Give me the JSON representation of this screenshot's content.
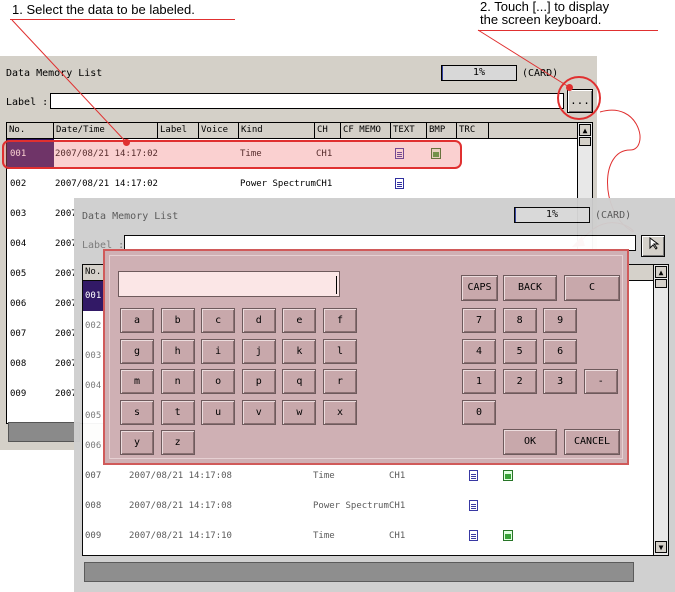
{
  "annotations": {
    "step1": "1. Select the data to be labeled.",
    "step2_line1": "2. Touch [...] to display",
    "step2_line2": "the screen keyboard."
  },
  "back_window": {
    "title": "Data Memory List",
    "progress": "1%",
    "progress_fraction": 0.01,
    "media": "(CARD)",
    "label_caption": "Label :",
    "ellipsis_button": "...",
    "columns": [
      "No.",
      "Date/Time",
      "Label",
      "Voice",
      "Kind",
      "CH",
      "CF MEMO",
      "TEXT",
      "BMP",
      "TRC"
    ],
    "rows": [
      {
        "no": "001",
        "datetime": "2007/08/21 14:17:02",
        "kind": "Time",
        "ch": "CH1",
        "text": true,
        "bmp": true
      },
      {
        "no": "002",
        "datetime": "2007/08/21 14:17:02",
        "kind": "Power Spectrum",
        "ch": "CH1",
        "text": true,
        "bmp": false
      },
      {
        "no": "003",
        "datetime": "2007",
        "kind": "",
        "ch": "",
        "text": false,
        "bmp": false
      },
      {
        "no": "004",
        "datetime": "2007",
        "kind": "",
        "ch": "",
        "text": false,
        "bmp": false
      },
      {
        "no": "005",
        "datetime": "2007",
        "kind": "",
        "ch": "",
        "text": false,
        "bmp": false
      },
      {
        "no": "006",
        "datetime": "2007",
        "kind": "",
        "ch": "",
        "text": false,
        "bmp": false
      },
      {
        "no": "007",
        "datetime": "2007",
        "kind": "",
        "ch": "",
        "text": false,
        "bmp": false
      },
      {
        "no": "008",
        "datetime": "2007",
        "kind": "",
        "ch": "",
        "text": false,
        "bmp": false
      },
      {
        "no": "009",
        "datetime": "2007",
        "kind": "",
        "ch": "",
        "text": false,
        "bmp": false
      }
    ]
  },
  "front_window": {
    "title": "Data Memory List",
    "progress": "1%",
    "media": "(CARD)",
    "label_caption": "Label :",
    "partial_header": "No.",
    "partial_rows": [
      "001",
      "002",
      "003",
      "004",
      "005",
      "006"
    ],
    "rows": [
      {
        "no": "007",
        "datetime": "2007/08/21 14:17:08",
        "kind": "Time",
        "ch": "CH1",
        "text": true,
        "bmp": true
      },
      {
        "no": "008",
        "datetime": "2007/08/21 14:17:08",
        "kind": "Power Spectrum",
        "ch": "CH1",
        "text": true,
        "bmp": false
      },
      {
        "no": "009",
        "datetime": "2007/08/21 14:17:10",
        "kind": "Time",
        "ch": "CH1",
        "text": true,
        "bmp": true
      }
    ]
  },
  "keyboard": {
    "input_value": "",
    "letters": [
      "a",
      "b",
      "c",
      "d",
      "e",
      "f",
      "g",
      "h",
      "i",
      "j",
      "k",
      "l",
      "m",
      "n",
      "o",
      "p",
      "q",
      "r",
      "s",
      "t",
      "u",
      "v",
      "w",
      "x",
      "y",
      "z"
    ],
    "digits": [
      "7",
      "8",
      "9",
      "4",
      "5",
      "6",
      "1",
      "2",
      "3",
      "-",
      "0"
    ],
    "caps": "CAPS",
    "back": "BACK",
    "clear": "C",
    "ok": "OK",
    "cancel": "CANCEL"
  },
  "colors": {
    "annotation_red": "#e03030",
    "selected_row": "#2a1060",
    "keyboard_bg": "#cfb0b4"
  }
}
